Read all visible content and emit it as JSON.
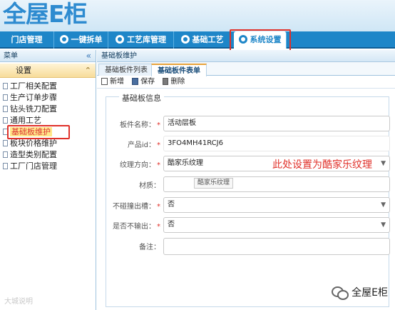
{
  "header": {
    "logo_text": "全屋E柜"
  },
  "nav": {
    "items": [
      {
        "label": "门店管理",
        "icon": "store-icon"
      },
      {
        "label": "一键拆单",
        "icon": "check-circle-icon"
      },
      {
        "label": "工艺库管理",
        "icon": "pen-icon"
      },
      {
        "label": "基础工艺",
        "icon": "shield-icon"
      },
      {
        "label": "系统设置",
        "icon": "settings-icon"
      }
    ],
    "active_index": 4
  },
  "sidebar": {
    "title": "菜单",
    "section": "设置",
    "items": [
      {
        "label": "工厂相关配置"
      },
      {
        "label": "生产订单步骤"
      },
      {
        "label": "钻头铣刀配置"
      },
      {
        "label": "通用工艺"
      },
      {
        "label": "基础板维护"
      },
      {
        "label": "板块价格维护"
      },
      {
        "label": "造型类别配置"
      },
      {
        "label": "工厂门店管理"
      }
    ],
    "selected_index": 4,
    "watermark": "大城说明"
  },
  "breadcrumb": "基础板维护",
  "tabs": [
    {
      "label": "基础板件列表"
    },
    {
      "label": "基础板件表单"
    }
  ],
  "toolbar": {
    "new_label": "新增",
    "save_label": "保存",
    "delete_label": "删除"
  },
  "form": {
    "title": "基础板信息",
    "fields": {
      "name": {
        "label": "板件名称：",
        "value": "活动层板",
        "required": true
      },
      "product_id": {
        "label": "产品id：",
        "value": "3FO4MH41RCJ6",
        "required": true
      },
      "texture": {
        "label": "纹理方向：",
        "value": "酷家乐纹理",
        "required": true
      },
      "material": {
        "label": "材质：",
        "value": ""
      },
      "no_slot": {
        "label": "不碰撞出槽：",
        "value": "否",
        "required": true
      },
      "no_output": {
        "label": "是否不输出：",
        "value": "否",
        "required": true
      },
      "remark": {
        "label": "备注：",
        "value": ""
      }
    },
    "annotation": "此处设置为酷家乐纹理",
    "tooltip": "酷家乐纹理"
  },
  "wechat_watermark": "全屋E柜",
  "colors": {
    "nav_blue": "#1e86c8",
    "highlight_red": "#e0312a"
  }
}
